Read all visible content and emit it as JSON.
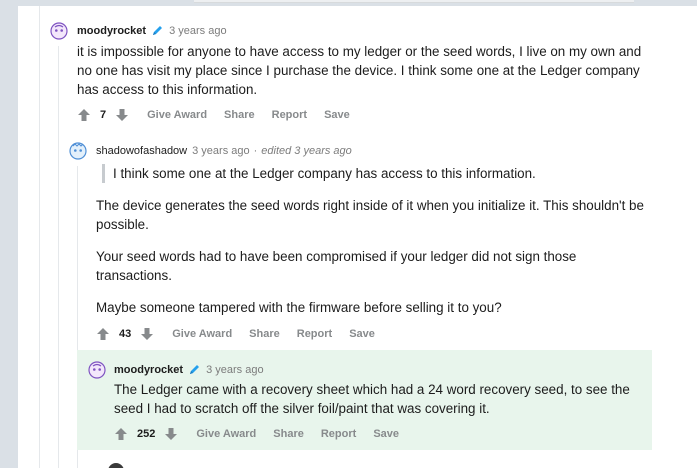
{
  "colors": {
    "background": "#dae0e6",
    "panel": "#ffffff",
    "highlight": "#e8f5ec",
    "meta": "#7c7c7c",
    "action": "#878a8c",
    "upvote": "#878a8c"
  },
  "comments": [
    {
      "author": "moodyrocket",
      "time": "3 years ago",
      "edited": "",
      "body": [
        "it is impossible for anyone to have access to my ledger or the seed words, I live on my own and no one has visit my place since I purchase the device. I think some one at the Ledger company has access to this information."
      ],
      "score": "7",
      "actions": [
        "Give Award",
        "Share",
        "Report",
        "Save"
      ],
      "icons": [
        "avatar-icon",
        "pencil-icon",
        "upvote-icon",
        "downvote-icon"
      ]
    },
    {
      "author": "shadowofashadow",
      "time": "3 years ago",
      "edited": "edited 3 years ago",
      "quote": "I think some one at the Ledger company has access to this information.",
      "body": [
        "The device generates the seed words right inside of it when you initialize it. This shouldn't be possible.",
        "Your seed words had to have been compromised if your ledger did not sign those transactions.",
        "Maybe someone tampered with the firmware before selling it to you?"
      ],
      "score": "43",
      "actions": [
        "Give Award",
        "Share",
        "Report",
        "Save"
      ]
    },
    {
      "author": "moodyrocket",
      "time": "3 years ago",
      "edited": "",
      "body": [
        "The Ledger came with a recovery sheet which had a 24 word recovery seed, to see the seed I had to scratch off the silver foil/paint that was covering it."
      ],
      "score": "252",
      "actions": [
        "Give Award",
        "Share",
        "Report",
        "Save"
      ]
    }
  ]
}
